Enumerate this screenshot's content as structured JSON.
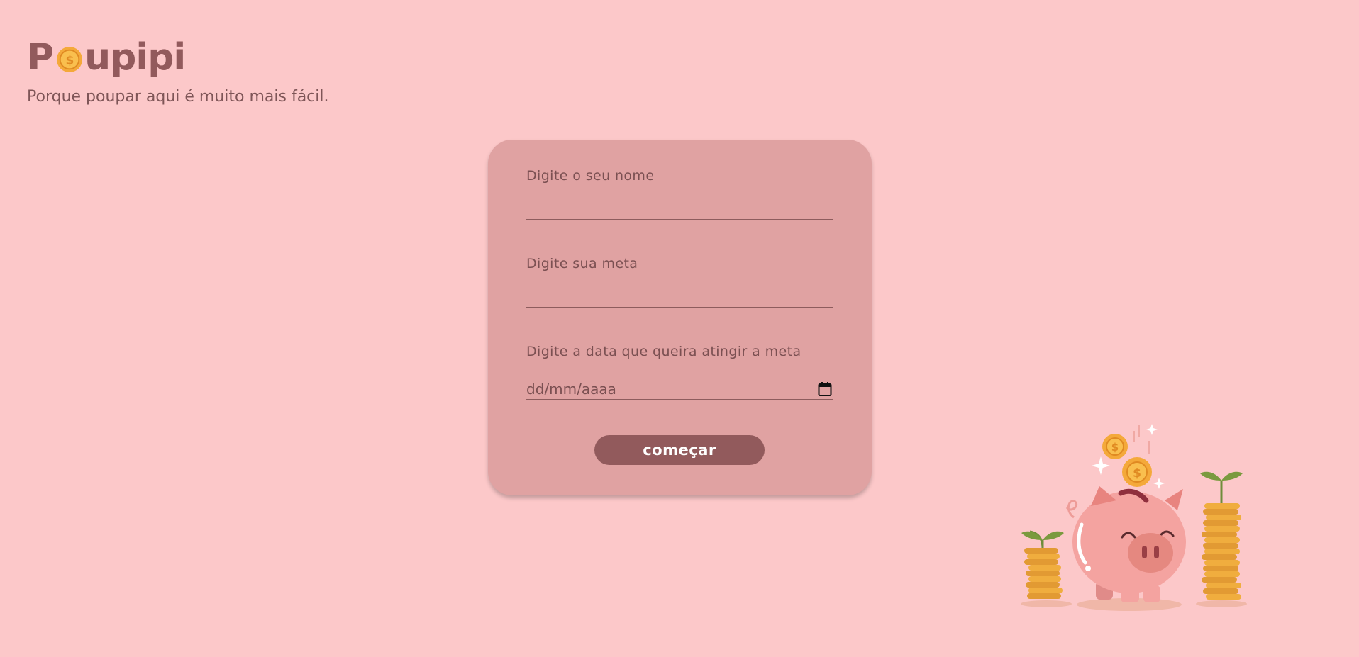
{
  "brand": {
    "logo_prefix": "P",
    "logo_suffix": "upipi",
    "tagline": "Porque poupar aqui é muito mais fácil."
  },
  "form": {
    "name_label": "Digite o seu nome",
    "goal_label": "Digite sua meta",
    "date_label": "Digite a data que queira atingir a meta",
    "date_placeholder": "dd/mm/aaaa",
    "submit_label": "começar"
  },
  "icons": {
    "logo_coin": "dollar-coin-icon",
    "date_picker": "calendar-icon",
    "illustration": "piggy-bank-illustration"
  },
  "colors": {
    "background": "#fcc8c9",
    "card": "#e0a2a2",
    "accent": "#925a5c",
    "coin": "#f4a93a"
  }
}
